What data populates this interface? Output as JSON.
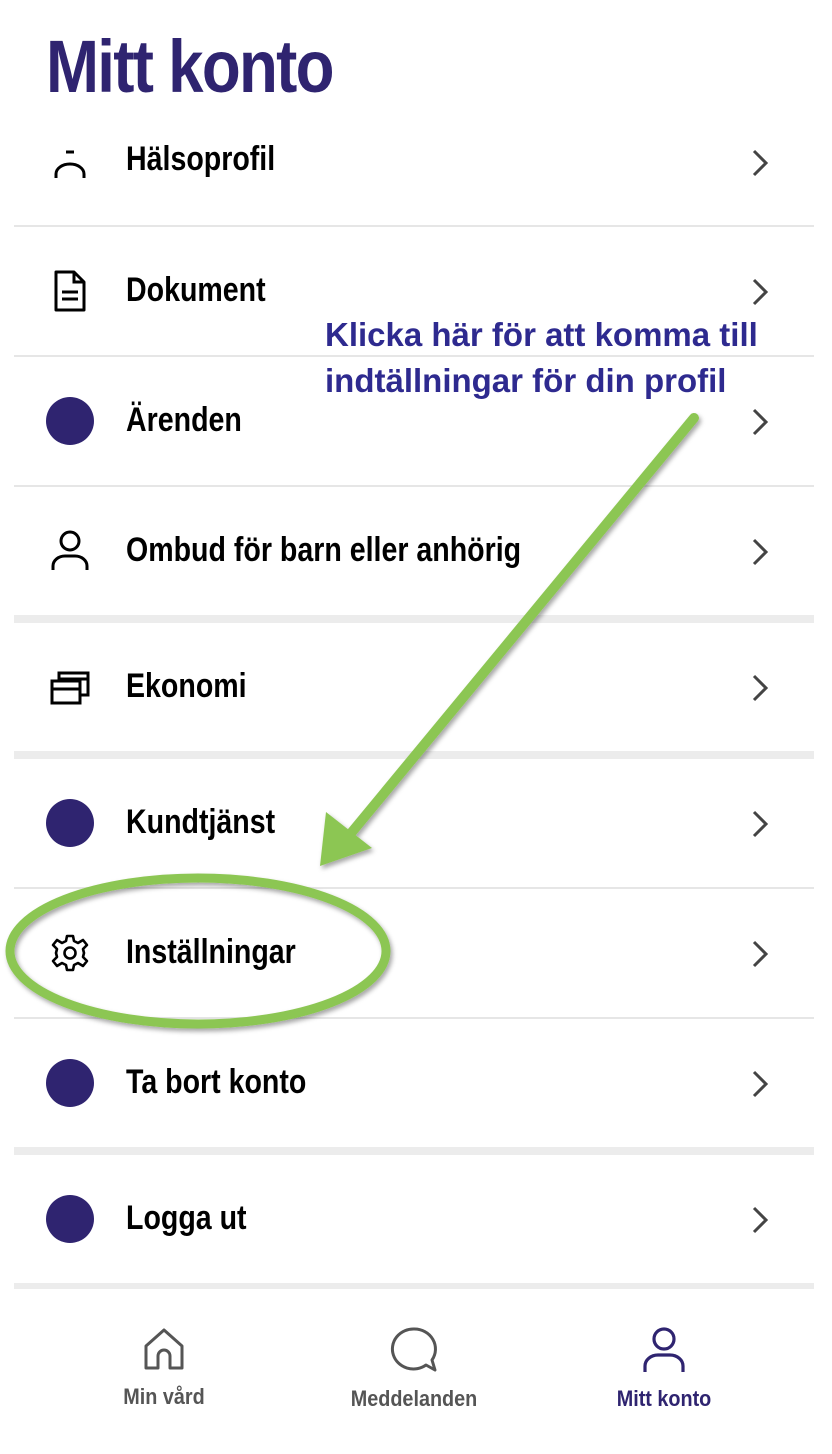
{
  "header": {
    "title": "Mitt konto"
  },
  "menu": {
    "items": [
      {
        "label": "Hälsoprofil",
        "icon": "health-profile-icon"
      },
      {
        "label": "Dokument",
        "icon": "document-icon"
      },
      {
        "label": "Ärenden",
        "icon": "placeholder-dot"
      },
      {
        "label": "Ombud för barn eller anhörig",
        "icon": "person-icon"
      },
      {
        "label": "Ekonomi",
        "icon": "wallet-cards-icon"
      },
      {
        "label": "Kundtjänst",
        "icon": "placeholder-dot"
      },
      {
        "label": "Inställningar",
        "icon": "gear-icon"
      },
      {
        "label": "Ta bort konto",
        "icon": "placeholder-dot"
      },
      {
        "label": "Logga ut",
        "icon": "placeholder-dot"
      }
    ]
  },
  "annotation": {
    "line1": "Klicka här för att komma till",
    "line2": "indtällningar för din profil",
    "arrow_color": "#8cc653",
    "text_color": "#2e2a8f"
  },
  "bottom_nav": {
    "items": [
      {
        "label": "Min vård",
        "icon": "home-icon",
        "active": false
      },
      {
        "label": "Meddelanden",
        "icon": "chat-bubble-icon",
        "active": false
      },
      {
        "label": "Mitt konto",
        "icon": "person-icon",
        "active": true
      }
    ]
  },
  "colors": {
    "brand": "#2f2470",
    "divider": "#e6e6e6"
  }
}
